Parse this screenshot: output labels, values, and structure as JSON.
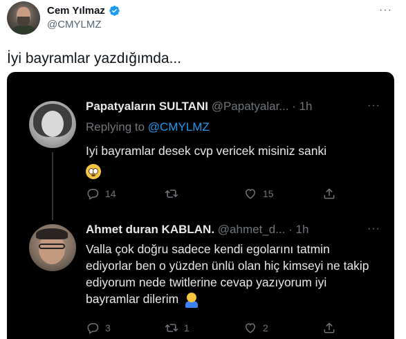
{
  "author": {
    "name": "Cem Yılmaz",
    "handle": "@CMYLMZ"
  },
  "more_symbol": "···",
  "tweet_text": "İyi bayramlar yazdığımda...",
  "embedded": {
    "reply1": {
      "name": "Papatyaların SULTANI",
      "meta": "@Papatyalar... · 1h",
      "replying_prefix": "Replying to ",
      "replying_handle": "@CMYLMZ",
      "text": "Iyi bayramlar desek cvp vericek misiniz sanki",
      "counts": {
        "reply": "14",
        "retweet": "",
        "like": "15"
      }
    },
    "reply2": {
      "name": "Ahmet duran KABLAN.",
      "meta": "@ahmet_d... · 1h",
      "text": "Valla çok doğru sadece kendi egolarını tatmin ediyorlar ben o yüzden ünlü olan hiç kimseyi ne takip ediyorum nede twitlerine cevap yazıyorum iyi bayramlar dilerim",
      "counts": {
        "reply": "3",
        "retweet": "1",
        "like": "2"
      }
    }
  },
  "colors": {
    "verified": "#1d9bf0",
    "link": "#1d9bf0",
    "dark_bg": "#000000",
    "dark_text": "#e7e9ea",
    "dark_secondary": "#71767b"
  },
  "icons": [
    "verified-badge-icon",
    "more-icon",
    "reply-icon",
    "retweet-icon",
    "like-icon",
    "share-icon"
  ]
}
